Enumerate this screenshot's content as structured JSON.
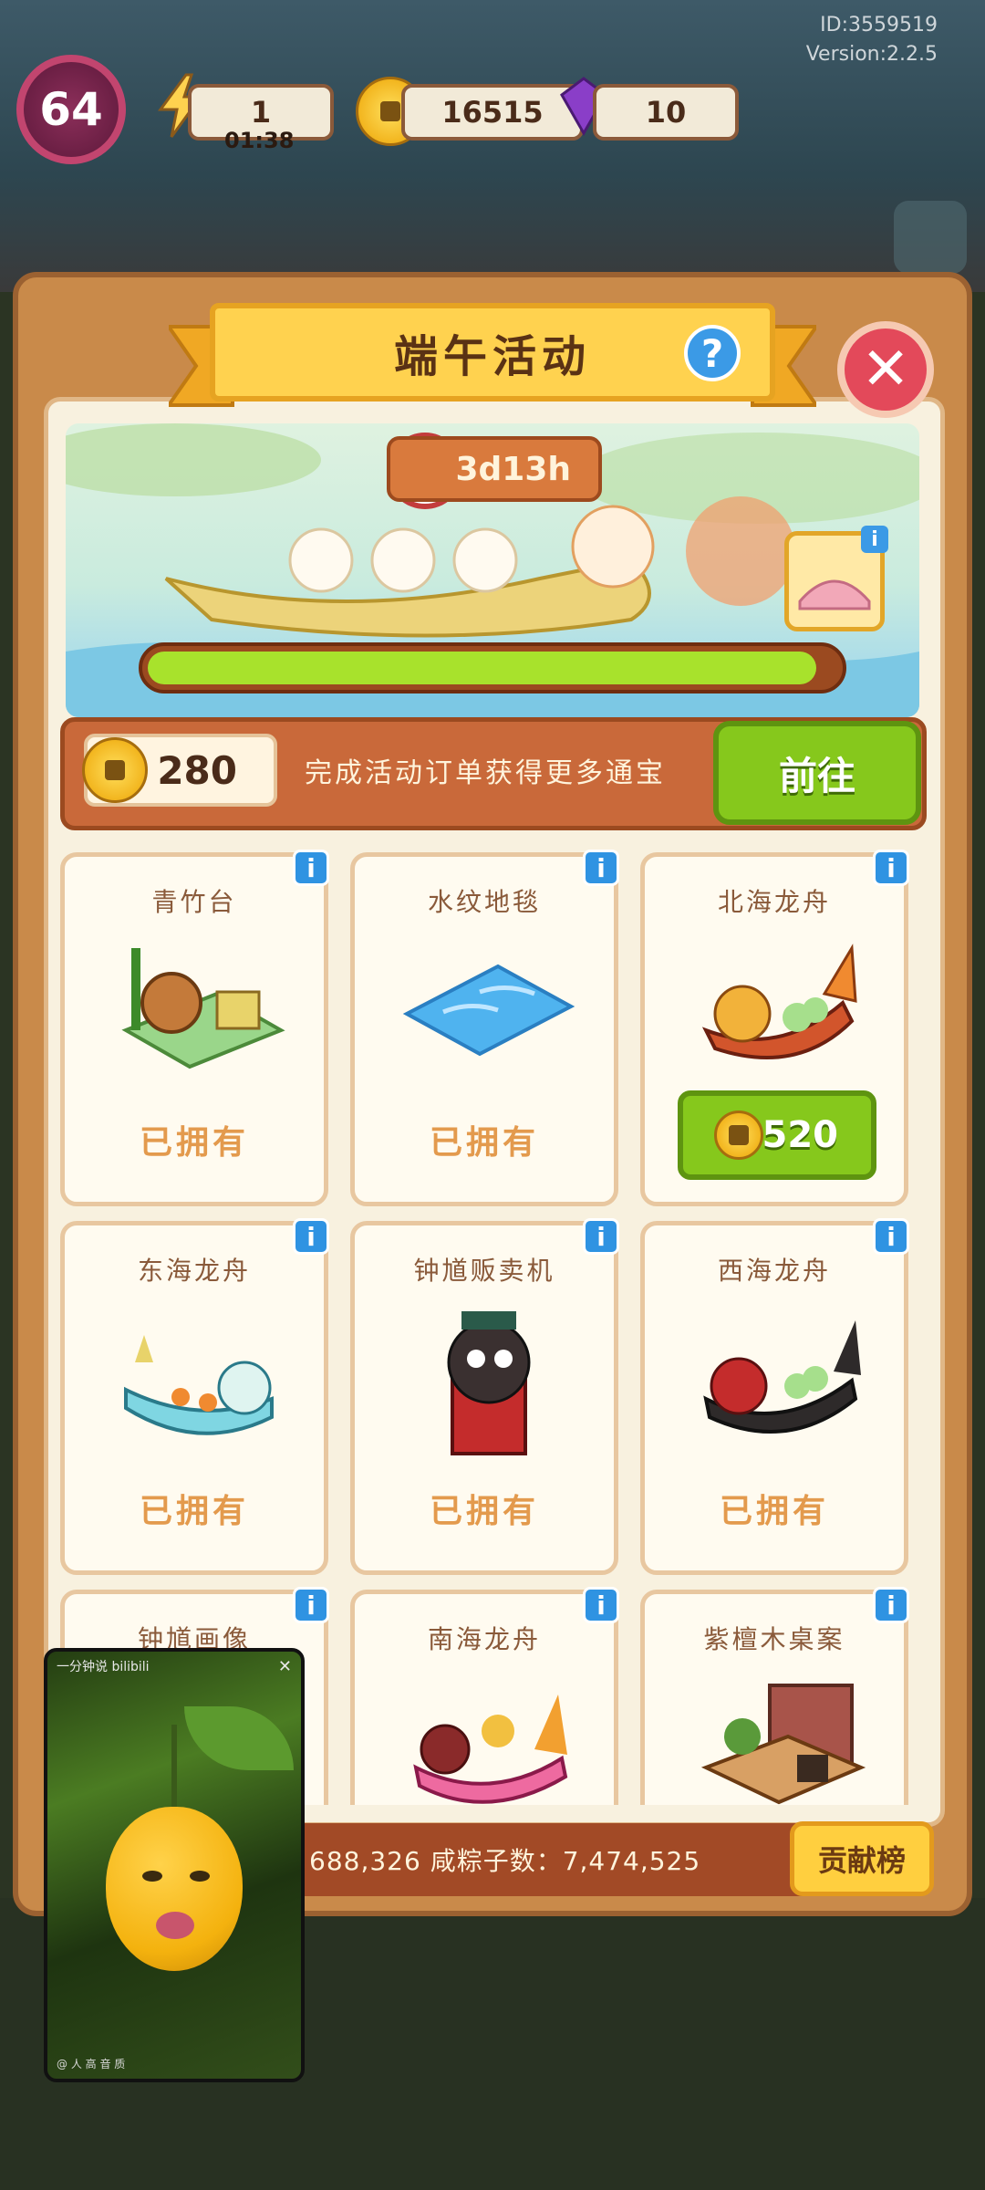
{
  "hud": {
    "id_text": "ID:3559519",
    "version_text": "Version:2.2.5",
    "level": "64",
    "energy": "1",
    "energy_timer": "01:38",
    "coins": "16515",
    "gems": "10"
  },
  "panel": {
    "title": "端午活动",
    "help_symbol": "?",
    "close_symbol": "✕",
    "timer": "3d13h",
    "progress_fraction": 0.97,
    "currency_amount": "280",
    "hint_text": "完成活动订单获得更多通宝",
    "go_label": "前往"
  },
  "items": [
    {
      "name": "青竹台",
      "status": "已拥有",
      "art": "bamboo-stage"
    },
    {
      "name": "水纹地毯",
      "status": "已拥有",
      "art": "water-rug"
    },
    {
      "name": "北海龙舟",
      "status": "",
      "price": "520",
      "art": "north-dragon-boat"
    },
    {
      "name": "东海龙舟",
      "status": "已拥有",
      "art": "east-dragon-boat"
    },
    {
      "name": "钟馗贩卖机",
      "status": "已拥有",
      "art": "zhongkui-vending"
    },
    {
      "name": "西海龙舟",
      "status": "已拥有",
      "art": "west-dragon-boat"
    },
    {
      "name": "钟馗画像",
      "status": "",
      "art": "zhongkui-portrait"
    },
    {
      "name": "南海龙舟",
      "status": "",
      "art": "south-dragon-boat"
    },
    {
      "name": "紫檀木桌案",
      "status": "",
      "art": "rosewood-table"
    }
  ],
  "footer": {
    "stats_text": "：688,326  咸粽子数：7,474,525",
    "rank_label": "贡献榜"
  },
  "video": {
    "top_text": "一分钟说 bilibili",
    "close_symbol": "✕",
    "bottom_text": "@ 人 高 音 质"
  },
  "colors": {
    "accent_green": "#86c81c",
    "panel_brown": "#c98a4a",
    "banner_yellow": "#ffd24f",
    "info_blue": "#2f93e2",
    "close_red": "#e3495a"
  }
}
